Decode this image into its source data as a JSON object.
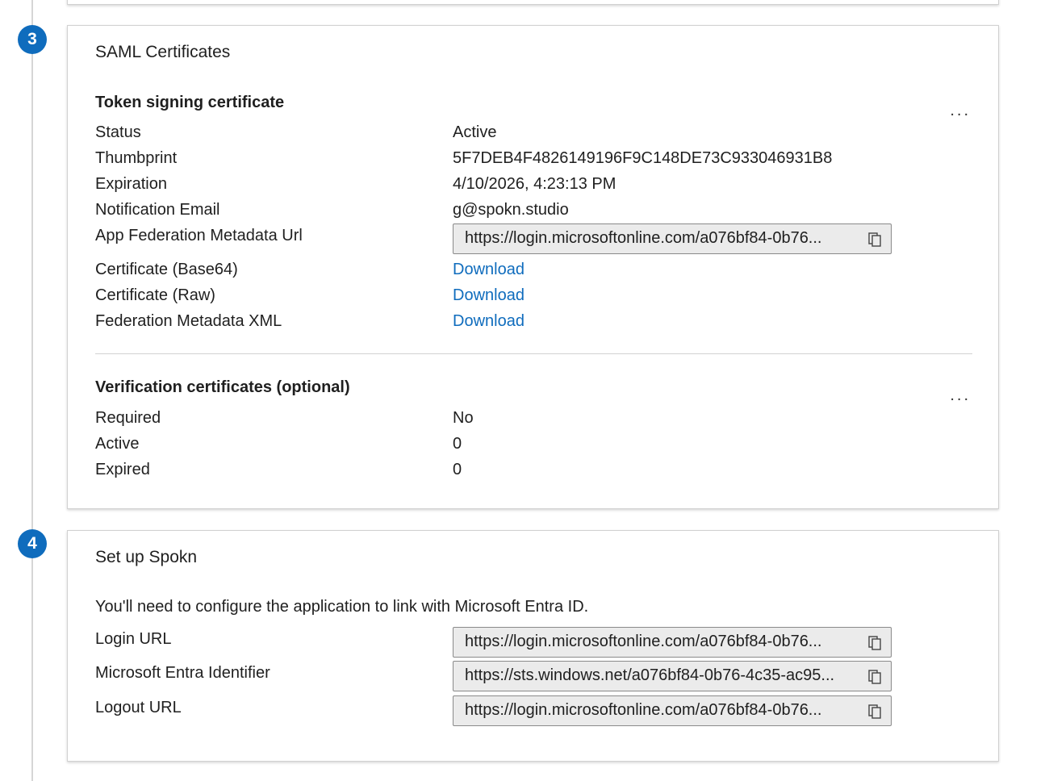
{
  "steps": {
    "step3": "3",
    "step4": "4"
  },
  "saml": {
    "title": "SAML Certificates",
    "token_section": {
      "heading": "Token signing certificate",
      "more": "...",
      "rows": [
        {
          "label": "Status",
          "value": "Active"
        },
        {
          "label": "Thumbprint",
          "value": "5F7DEB4F4826149196F9C148DE73C933046931B8"
        },
        {
          "label": "Expiration",
          "value": "4/10/2026, 4:23:13 PM"
        },
        {
          "label": "Notification Email",
          "value": "g@spokn.studio"
        }
      ],
      "metadata_url": {
        "label": "App Federation Metadata Url",
        "value": "https://login.microsoftonline.com/a076bf84-0b76..."
      },
      "downloads": [
        {
          "label": "Certificate (Base64)",
          "link": "Download"
        },
        {
          "label": "Certificate (Raw)",
          "link": "Download"
        },
        {
          "label": "Federation Metadata XML",
          "link": "Download"
        }
      ]
    },
    "verification_section": {
      "heading": "Verification certificates (optional)",
      "more": "...",
      "rows": [
        {
          "label": "Required",
          "value": "No"
        },
        {
          "label": "Active",
          "value": "0"
        },
        {
          "label": "Expired",
          "value": "0"
        }
      ]
    }
  },
  "setup": {
    "title": "Set up Spokn",
    "description": "You'll need to configure the application to link with Microsoft Entra ID.",
    "fields": [
      {
        "label": "Login URL",
        "value": "https://login.microsoftonline.com/a076bf84-0b76..."
      },
      {
        "label": "Microsoft Entra Identifier",
        "value": "https://sts.windows.net/a076bf84-0b76-4c35-ac95..."
      },
      {
        "label": "Logout URL",
        "value": "https://login.microsoftonline.com/a076bf84-0b76..."
      }
    ]
  },
  "colors": {
    "accent": "#0f6cbd",
    "url_box_bg": "#ebebeb"
  },
  "icons": {
    "copy": "copy-icon",
    "more": "more-icon"
  }
}
